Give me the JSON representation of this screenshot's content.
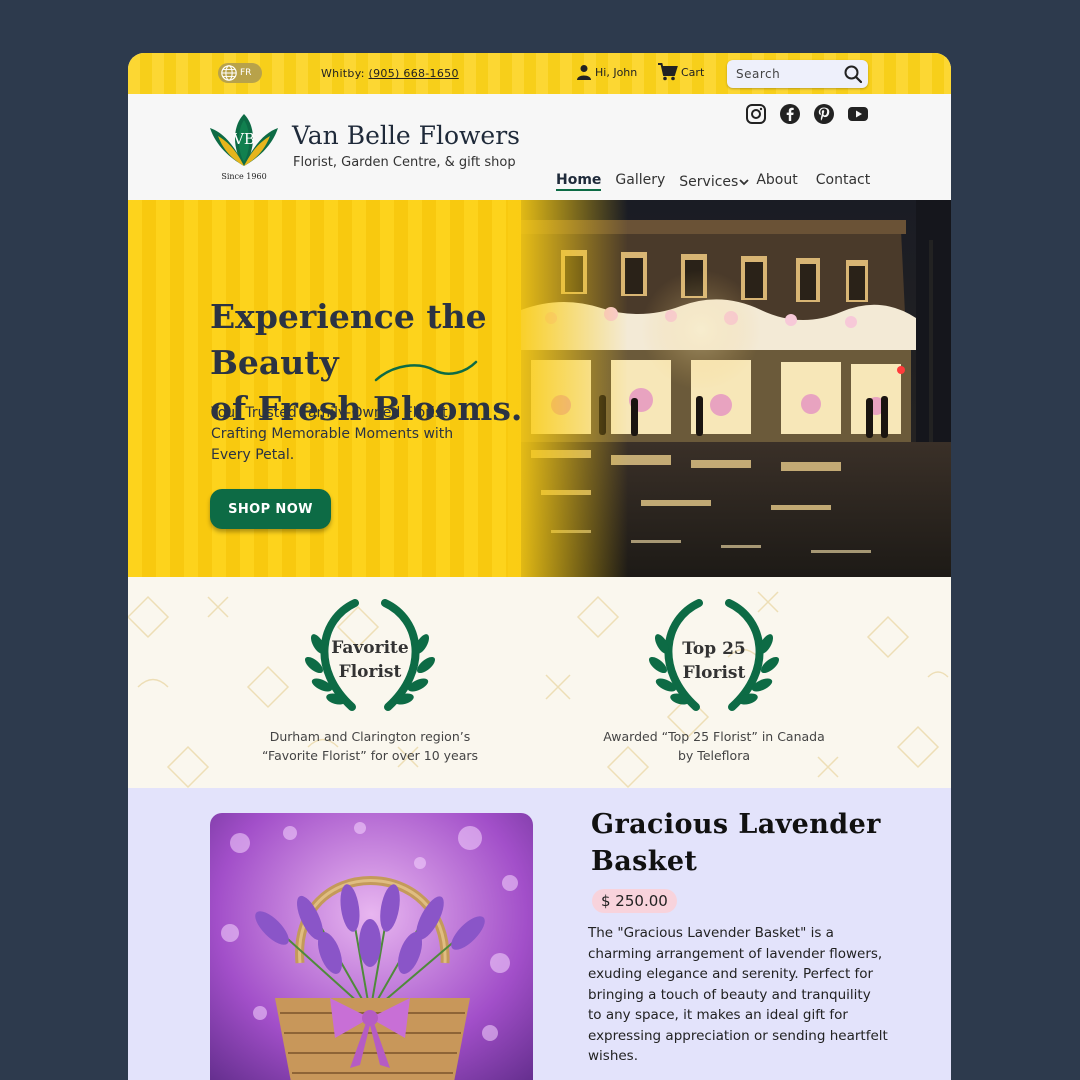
{
  "topbar": {
    "lang": "FR",
    "location_label": "Whitby:",
    "phone": "(905) 668-1650",
    "user_greeting": "Hi, John",
    "cart_label": "Cart",
    "search_placeholder": "Search"
  },
  "header": {
    "brand_name": "Van Belle Flowers",
    "tagline": "Florist, Garden Centre, & gift shop",
    "logo_initials": "VB",
    "logo_since": "Since 1960",
    "social": [
      "instagram-icon",
      "facebook-icon",
      "pinterest-icon",
      "youtube-icon"
    ],
    "nav": [
      "Home",
      "Gallery",
      "Services",
      "About",
      "Contact"
    ],
    "active_nav": "Home"
  },
  "hero": {
    "title_line1": "Experience the Beauty",
    "title_line2": "of Fresh Blooms.",
    "subtitle": "Your Trusted Family-Owned Florist, Crafting Memorable Moments with Every Petal.",
    "cta": "SHOP NOW"
  },
  "awards": [
    {
      "title_line1": "Favorite",
      "title_line2": "Florist",
      "desc_line1": "Durham and Clarington region’s",
      "desc_line2": "“Favorite Florist” for over 10 years"
    },
    {
      "title_line1": "Top 25",
      "title_line2": "Florist",
      "desc_line1": "Awarded “Top 25 Florist” in Canada",
      "desc_line2": "by Teleflora"
    }
  ],
  "product": {
    "title": "Gracious Lavender Basket",
    "price": "$ 250.00",
    "description": "The \"Gracious Lavender Basket\" is a charming arrangement of lavender flowers, exuding elegance and serenity. Perfect for bringing a touch of beauty and tranquility to any space, it makes an ideal gift for expressing appreciation or sending heartfelt wishes."
  },
  "colors": {
    "brand_green": "#0d6b45",
    "brand_yellow": "#fcd733",
    "page_bg": "#2d3a4d",
    "product_bg": "#e3e3fb",
    "price_badge": "#f8d3dc"
  }
}
